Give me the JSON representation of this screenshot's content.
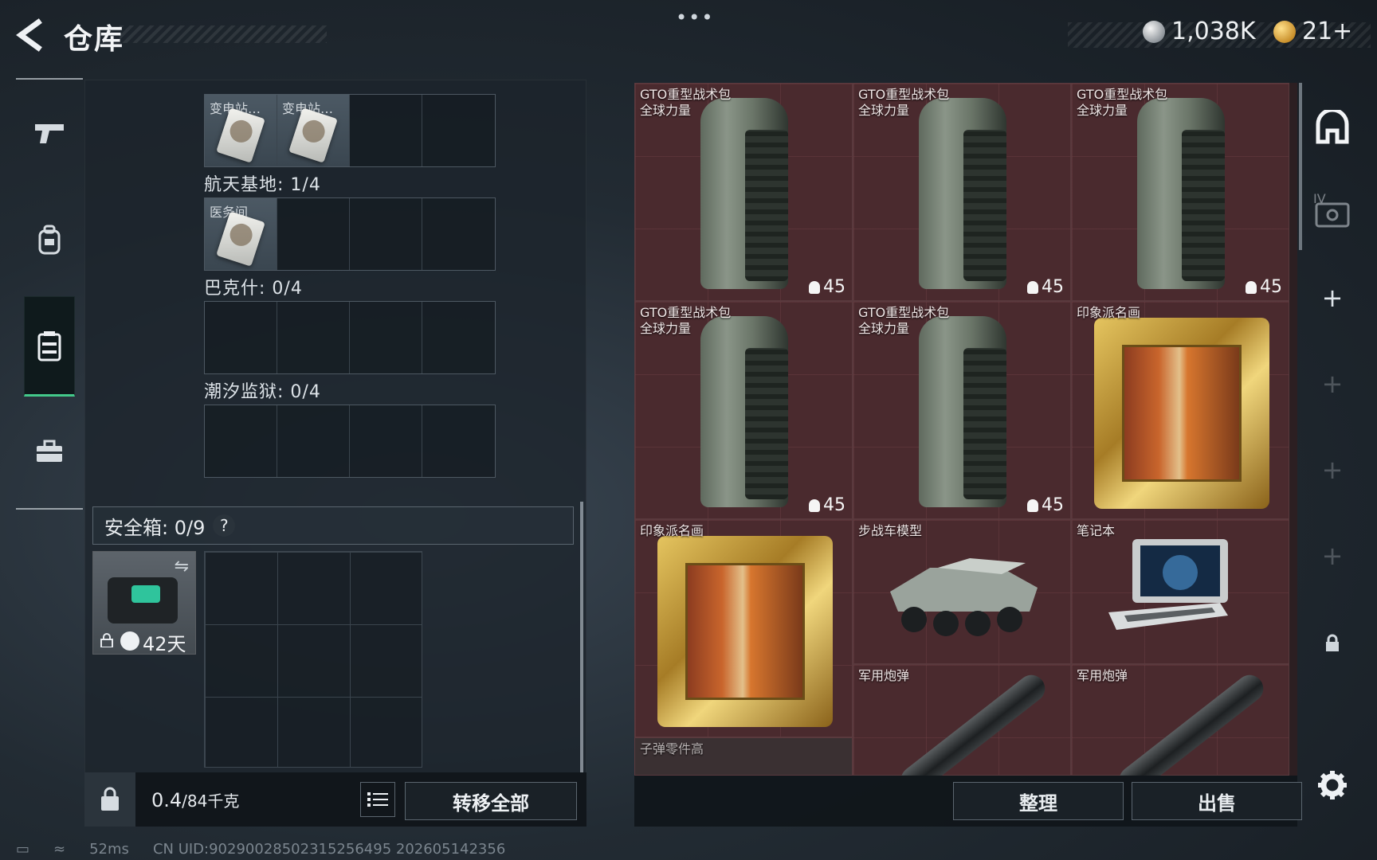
{
  "header": {
    "title": "仓库",
    "top_dots": "•••",
    "currencies": [
      {
        "icon": "silver-coin-icon",
        "value": "1,038K"
      },
      {
        "icon": "gold-coin-icon",
        "value": "21+"
      }
    ]
  },
  "left_nav": {
    "items": [
      {
        "id": "weapons",
        "icon": "pistol-icon"
      },
      {
        "id": "gear",
        "icon": "backpack-icon"
      },
      {
        "id": "storage",
        "icon": "chest-rig-icon",
        "active": true
      },
      {
        "id": "toolbox",
        "icon": "toolbox-icon"
      }
    ]
  },
  "key_sections": [
    {
      "label": "",
      "slots": [
        {
          "label": "变电站…",
          "filled": true
        },
        {
          "label": "变电站…",
          "filled": true
        },
        {
          "label": "",
          "filled": false
        },
        {
          "label": "",
          "filled": false
        }
      ]
    },
    {
      "label": "航天基地: 1/4",
      "slots": [
        {
          "label": "医务间",
          "filled": true
        },
        {
          "label": "",
          "filled": false
        },
        {
          "label": "",
          "filled": false
        },
        {
          "label": "",
          "filled": false
        }
      ]
    },
    {
      "label": "巴克什: 0/4",
      "slots": [
        {
          "label": "",
          "filled": false
        },
        {
          "label": "",
          "filled": false
        },
        {
          "label": "",
          "filled": false
        },
        {
          "label": "",
          "filled": false
        }
      ]
    },
    {
      "label": "潮汐监狱: 0/4",
      "slots": [
        {
          "label": "",
          "filled": false
        },
        {
          "label": "",
          "filled": false
        },
        {
          "label": "",
          "filled": false
        },
        {
          "label": "",
          "filled": false
        }
      ]
    }
  ],
  "safe_box": {
    "label": "安全箱: 0/9",
    "help": "?",
    "item_days": "42天"
  },
  "bottom_left": {
    "weight_value": "0.4",
    "weight_capacity": "/84千克",
    "transfer_all": "转移全部"
  },
  "inventory": {
    "items": [
      {
        "name_line1": "GTO重型战术包",
        "name_line2": "全球力量",
        "count": "45",
        "kind": "backpack"
      },
      {
        "name_line1": "GTO重型战术包",
        "name_line2": "全球力量",
        "count": "45",
        "kind": "backpack"
      },
      {
        "name_line1": "GTO重型战术包",
        "name_line2": "全球力量",
        "count": "45",
        "kind": "backpack"
      },
      {
        "name_line1": "GTO重型战术包",
        "name_line2": "全球力量",
        "count": "45",
        "kind": "backpack"
      },
      {
        "name_line1": "GTO重型战术包",
        "name_line2": "全球力量",
        "count": "45",
        "kind": "backpack"
      },
      {
        "name_line1": "印象派名画",
        "name_line2": "",
        "count": "",
        "kind": "painting"
      },
      {
        "name_line1": "印象派名画",
        "name_line2": "",
        "count": "",
        "kind": "painting"
      },
      {
        "name_line1": "步战车模型",
        "name_line2": "",
        "count": "",
        "kind": "vehicle"
      },
      {
        "name_line1": "笔记本",
        "name_line2": "",
        "count": "",
        "kind": "laptop"
      },
      {
        "name_line1": "军用炮弹",
        "name_line2": "",
        "count": "",
        "kind": "shell"
      },
      {
        "name_line1": "军用炮弹",
        "name_line2": "",
        "count": "",
        "kind": "shell"
      },
      {
        "name_line1": "子弹零件高",
        "name_line2": "",
        "count": "",
        "kind": "parts"
      }
    ],
    "sort_label": "整理",
    "sell_label": "出售"
  },
  "right_sidebar": {
    "icons": [
      "container-icon",
      "tier-four-case-icon",
      "plus-icon",
      "plus-icon",
      "plus-icon",
      "plus-icon",
      "lock-icon",
      "settings-gear-icon"
    ],
    "tier_label": "IV"
  },
  "statusbar": {
    "ping": "52ms",
    "uid": "CN UID:9029002850231525649​5 202605142356"
  },
  "colors": {
    "accent_green": "#43c98a",
    "inventory_bg": "#4a2a2e"
  }
}
